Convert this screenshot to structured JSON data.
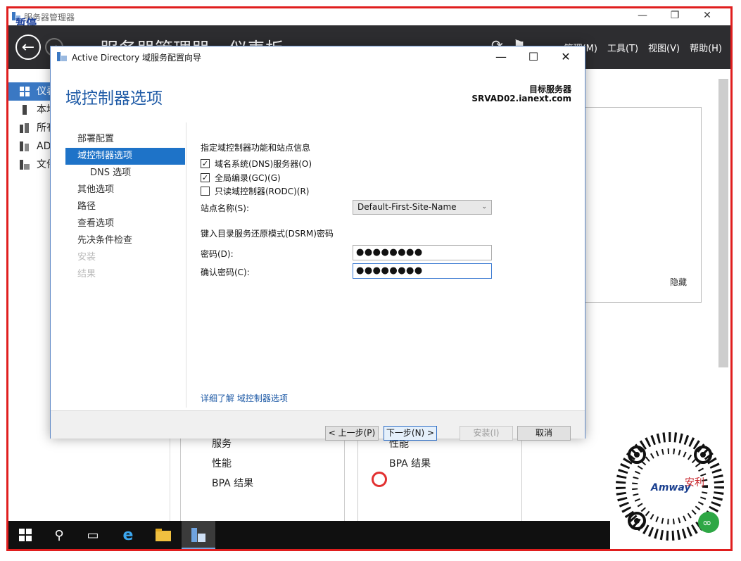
{
  "server_manager": {
    "window_title": "服务器管理器",
    "paused_label": "暂停",
    "breadcrumb": "服务器管理器 › 仪表板",
    "menu": [
      "管理(M)",
      "工具(T)",
      "视图(V)",
      "帮助(H)"
    ],
    "nav_items": [
      "仪表板",
      "本地服务器",
      "所有服务器",
      "AD DS",
      "文件和存储服务"
    ],
    "panel_hide": "隐藏",
    "tile_left": [
      "服务",
      "性能",
      "BPA 结果"
    ],
    "tile_right": [
      "性能",
      "BPA 结果"
    ]
  },
  "dialog": {
    "title": "Active Directory 域服务配置向导",
    "heading": "域控制器选项",
    "target_label": "目标服务器",
    "target_server": "SRVAD02.ianext.com",
    "steps": [
      {
        "label": "部署配置",
        "state": "normal"
      },
      {
        "label": "域控制器选项",
        "state": "selected"
      },
      {
        "label": "DNS 选项",
        "state": "sub"
      },
      {
        "label": "其他选项",
        "state": "normal"
      },
      {
        "label": "路径",
        "state": "normal"
      },
      {
        "label": "查看选项",
        "state": "normal"
      },
      {
        "label": "先决条件检查",
        "state": "normal"
      },
      {
        "label": "安装",
        "state": "disabled"
      },
      {
        "label": "结果",
        "state": "disabled"
      }
    ],
    "section_title": "指定域控制器功能和站点信息",
    "checkboxes": [
      {
        "label": "域名系统(DNS)服务器(O)",
        "checked": true
      },
      {
        "label": "全局编录(GC)(G)",
        "checked": true
      },
      {
        "label": "只读域控制器(RODC)(R)",
        "checked": false
      }
    ],
    "site_label": "站点名称(S):",
    "site_value": "Default-First-Site-Name",
    "dsrm_title": "键入目录服务还原模式(DSRM)密码",
    "password_label": "密码(D):",
    "password_value": "●●●●●●●●",
    "confirm_label": "确认密码(C):",
    "confirm_value": "●●●●●●●●",
    "learn_more": "详细了解 域控制器选项",
    "buttons": {
      "prev": "< 上一步(P)",
      "next": "下一步(N) >",
      "install": "安装(I)",
      "cancel": "取消"
    }
  },
  "qr": {
    "brand": "Amway",
    "brand_cn": "安利"
  },
  "colors": {
    "accent": "#1e73c8",
    "heading": "#1e5aa6",
    "header_bg": "#2d2d30",
    "frame_red": "#e01e1e"
  }
}
